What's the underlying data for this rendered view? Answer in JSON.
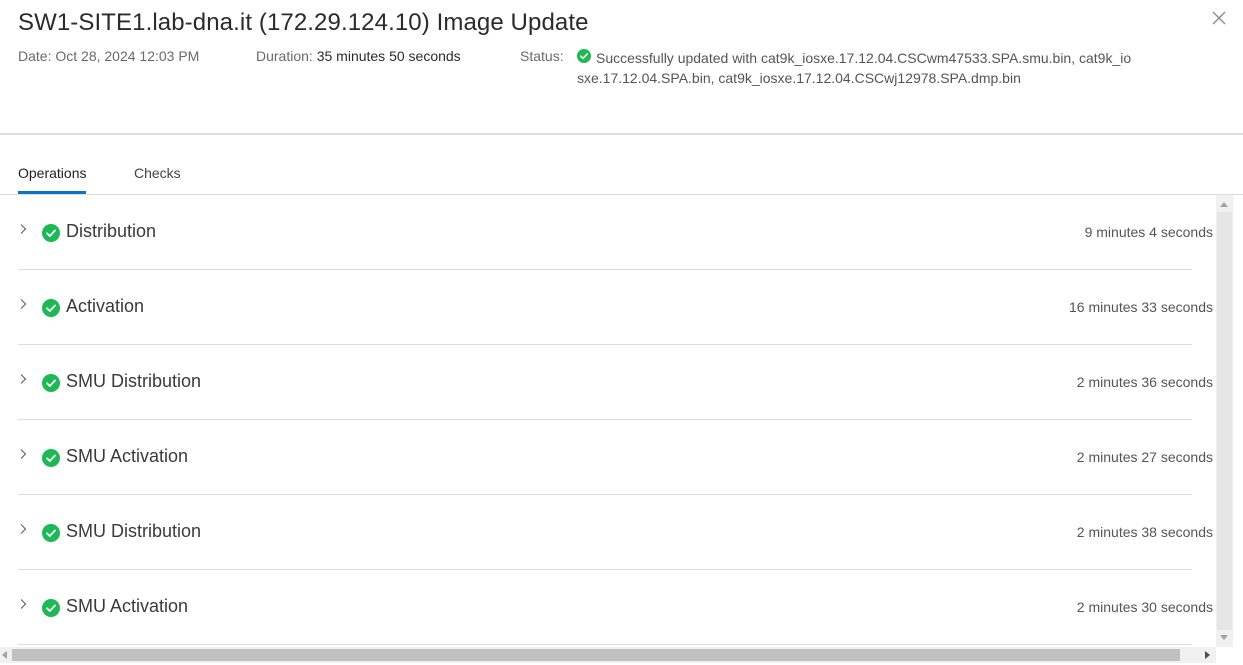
{
  "dialog": {
    "title": "SW1-SITE1.lab-dna.it (172.29.124.10) Image Update",
    "close_icon": "close-icon"
  },
  "meta": {
    "date_label": "Date:",
    "date_value": "Oct 28, 2024 12:03 PM",
    "duration_label": "Duration:",
    "duration_value": "35 minutes 50 seconds",
    "status_label": "Status:",
    "status_icon": "success-check-icon",
    "status_value": "Successfully updated with cat9k_iosxe.17.12.04.CSCwm47533.SPA.smu.bin, cat9k_iosxe.17.12.04.SPA.bin, cat9k_iosxe.17.12.04.CSCwj12978.SPA.dmp.bin"
  },
  "tabs": [
    {
      "label": "Operations",
      "active": true
    },
    {
      "label": "Checks",
      "active": false
    }
  ],
  "operations": [
    {
      "name": "Distribution",
      "duration": "9 minutes 4 seconds",
      "status": "success"
    },
    {
      "name": "Activation",
      "duration": "16 minutes 33 seconds",
      "status": "success"
    },
    {
      "name": "SMU Distribution",
      "duration": "2 minutes 36 seconds",
      "status": "success"
    },
    {
      "name": "SMU Activation",
      "duration": "2 minutes 27 seconds",
      "status": "success"
    },
    {
      "name": "SMU Distribution",
      "duration": "2 minutes 38 seconds",
      "status": "success"
    },
    {
      "name": "SMU Activation",
      "duration": "2 minutes 30 seconds",
      "status": "success"
    }
  ],
  "colors": {
    "success": "#1db954",
    "active_tab": "#0a74c4",
    "divider": "#dcdcdc"
  }
}
